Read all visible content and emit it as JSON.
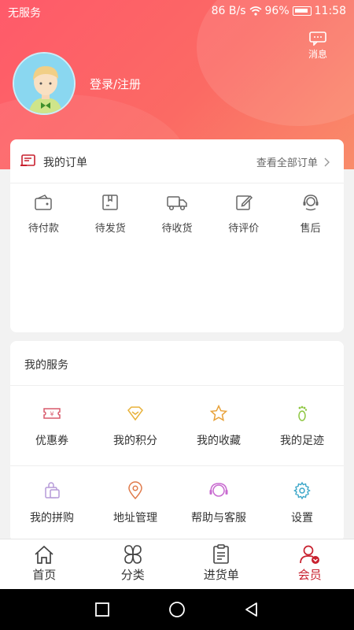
{
  "status_bar": {
    "carrier": "无服务",
    "speed": "86 B/s",
    "battery": "96%",
    "time": "11:58"
  },
  "header": {
    "message_label": "消息",
    "login_label": "登录/注册"
  },
  "orders": {
    "title": "我的订单",
    "view_all": "查看全部订单",
    "items": [
      {
        "label": "待付款",
        "icon": "wallet-icon"
      },
      {
        "label": "待发货",
        "icon": "package-icon"
      },
      {
        "label": "待收货",
        "icon": "truck-icon"
      },
      {
        "label": "待评价",
        "icon": "edit-icon"
      },
      {
        "label": "售后",
        "icon": "headset-icon"
      }
    ]
  },
  "services": {
    "title": "我的服务",
    "items": [
      {
        "label": "优惠券",
        "icon": "coupon-icon",
        "color": "#d85a6c"
      },
      {
        "label": "我的积分",
        "icon": "points-icon",
        "color": "#e8b23a"
      },
      {
        "label": "我的收藏",
        "icon": "star-icon",
        "color": "#e8a23a"
      },
      {
        "label": "我的足迹",
        "icon": "footprint-icon",
        "color": "#8cc63e"
      },
      {
        "label": "我的拼购",
        "icon": "shopping-bag-icon",
        "color": "#b59ad8"
      },
      {
        "label": "地址管理",
        "icon": "location-pin-icon",
        "color": "#e07a4a"
      },
      {
        "label": "帮助与客服",
        "icon": "help-headset-icon",
        "color": "#c86ad0"
      },
      {
        "label": "设置",
        "icon": "gear-icon",
        "color": "#3aa6c8"
      }
    ]
  },
  "tabbar": {
    "items": [
      {
        "label": "首页",
        "icon": "home-icon",
        "active": false
      },
      {
        "label": "分类",
        "icon": "category-icon",
        "active": false
      },
      {
        "label": "进货单",
        "icon": "order-list-icon",
        "active": false
      },
      {
        "label": "会员",
        "icon": "member-icon",
        "active": true
      }
    ]
  },
  "colors": {
    "accent": "#c8202e",
    "hero_start": "#ff5a6a",
    "hero_end": "#f98c6a"
  }
}
